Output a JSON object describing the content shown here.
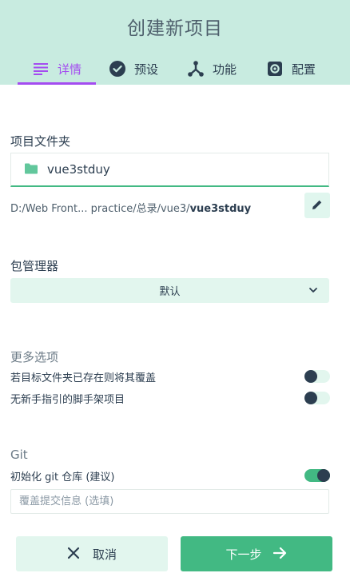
{
  "header": {
    "title": "创建新项目",
    "tabs": [
      {
        "label": "详情",
        "icon": "list-icon",
        "active": true
      },
      {
        "label": "预设",
        "icon": "check-circle-icon",
        "active": false
      },
      {
        "label": "功能",
        "icon": "fork-icon",
        "active": false
      },
      {
        "label": "配置",
        "icon": "gear-icon",
        "active": false
      }
    ]
  },
  "details": {
    "folder_label": "项目文件夹",
    "folder_value": "vue3stduy",
    "path_prefix": "D:/Web Front... practice/总录/vue3/",
    "path_folder": "vue3stduy"
  },
  "package_manager": {
    "label": "包管理器",
    "selected": "默认"
  },
  "more_options": {
    "label": "更多选项",
    "items": [
      {
        "label": "若目标文件夹已存在则将其覆盖",
        "enabled": false
      },
      {
        "label": "无新手指引的脚手架项目",
        "enabled": false
      }
    ]
  },
  "git": {
    "label": "Git",
    "init_label": "初始化 git 仓库 (建议)",
    "init_enabled": true,
    "commit_placeholder": "覆盖提交信息 (选填)"
  },
  "footer": {
    "cancel_label": "取消",
    "next_label": "下一步"
  },
  "colors": {
    "header_bg": "#c8ebe0",
    "accent_purple": "#a44cf0",
    "accent_green": "#42b983",
    "light_green": "#e2f6ee",
    "text_dark": "#2c3e50"
  }
}
